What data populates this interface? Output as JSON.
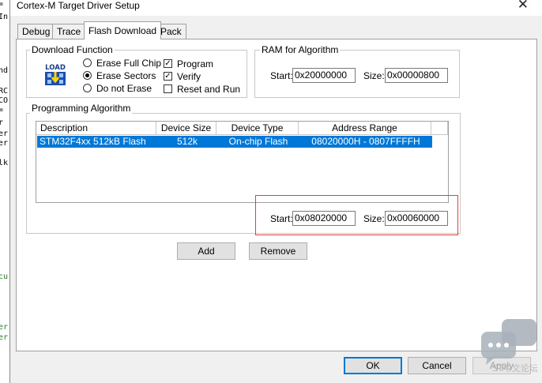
{
  "background_code_fragments": [
    "nd",
    "=",
    "In",
    "RC",
    "CO",
    "=",
    "r",
    "er",
    "er",
    "lk",
    "cu",
    "er",
    "er"
  ],
  "dialog": {
    "title": "Cortex-M Target Driver Setup",
    "close_glyph": "✕"
  },
  "tabs": [
    {
      "label": "Debug"
    },
    {
      "label": "Trace"
    },
    {
      "label": "Flash Download"
    },
    {
      "label": "Pack"
    }
  ],
  "download_function": {
    "title": "Download Function",
    "icon_text_top": "LOAD",
    "radios": [
      {
        "label": "Erase Full Chip",
        "checked": false
      },
      {
        "label": "Erase Sectors",
        "checked": true
      },
      {
        "label": "Do not Erase",
        "checked": false
      }
    ],
    "checks": [
      {
        "label": "Program",
        "checked": true
      },
      {
        "label": "Verify",
        "checked": true
      },
      {
        "label": "Reset and Run",
        "checked": false
      }
    ]
  },
  "ram_for_algorithm": {
    "title": "RAM for Algorithm",
    "start_label": "Start:",
    "start_value": "0x20000000",
    "size_label": "Size:",
    "size_value": "0x00000800"
  },
  "programming_algorithm": {
    "title": "Programming Algorithm",
    "columns": [
      "Description",
      "Device Size",
      "Device Type",
      "Address Range"
    ],
    "rows": [
      {
        "description": "STM32F4xx 512kB Flash",
        "device_size": "512k",
        "device_type": "On-chip Flash",
        "address_range": "08020000H - 0807FFFFH"
      }
    ],
    "start_label": "Start:",
    "start_value": "0x08020000",
    "size_label": "Size:",
    "size_value": "0x00060000"
  },
  "buttons": {
    "add": "Add",
    "remove": "Remove",
    "ok": "OK",
    "cancel": "Cancel",
    "apply": "Apply"
  },
  "watermark": {
    "text": "ST中文论坛"
  },
  "colors": {
    "selection": "#0078d7",
    "highlight_box": "#e04040",
    "dialog_bg": "#f0f0f0"
  }
}
